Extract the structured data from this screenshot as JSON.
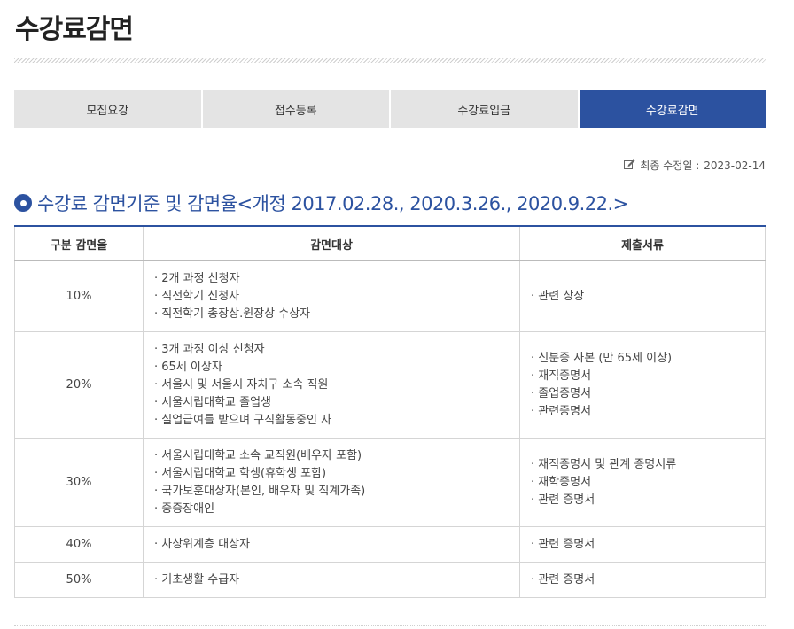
{
  "page_title": "수강료감면",
  "tabs": [
    {
      "label": "모집요강",
      "active": false
    },
    {
      "label": "접수등록",
      "active": false
    },
    {
      "label": "수강료입금",
      "active": false
    },
    {
      "label": "수강료감면",
      "active": true
    }
  ],
  "updated": {
    "label": "최종 수정일 :",
    "date": "2023-02-14",
    "icon": "edit-icon"
  },
  "section_title": "수강료 감면기준 및 감면율<개정 2017.02.28., 2020.3.26., 2020.9.22.>",
  "table": {
    "headers": [
      "구분 감면율",
      "감면대상",
      "제출서류"
    ],
    "rows": [
      {
        "rate": "10%",
        "targets": [
          "2개 과정 신청자",
          "직전학기 신청자",
          "직전학기 총장상.원장상 수상자"
        ],
        "documents": [
          "관련 상장"
        ]
      },
      {
        "rate": "20%",
        "targets": [
          "3개 과정 이상 신청자",
          "65세 이상자",
          "서울시 및 서울시 자치구 소속 직원",
          "서울시립대학교 졸업생",
          "실업급여를 받으며 구직활동중인 자"
        ],
        "documents": [
          "신분증 사본 (만 65세 이상)",
          "재직증명서",
          "졸업증명서",
          "관련증명서"
        ]
      },
      {
        "rate": "30%",
        "targets": [
          "서울시립대학교 소속 교직원(배우자 포함)",
          "서울시립대학교 학생(휴학생 포함)",
          "국가보훈대상자(본인, 배우자 및 직계가족)",
          "중증장애인"
        ],
        "documents": [
          "재직증명서 및 관계 증명서류",
          "재학증명서",
          "관련 증명서"
        ]
      },
      {
        "rate": "40%",
        "targets": [
          "차상위계층 대상자"
        ],
        "documents": [
          "관련 증명서"
        ]
      },
      {
        "rate": "50%",
        "targets": [
          "기초생활 수급자"
        ],
        "documents": [
          "관련 증명서"
        ]
      }
    ]
  },
  "colors": {
    "accent": "#2c52a0",
    "tab_bg": "#e4e4e4",
    "border": "#d5d5d5"
  }
}
